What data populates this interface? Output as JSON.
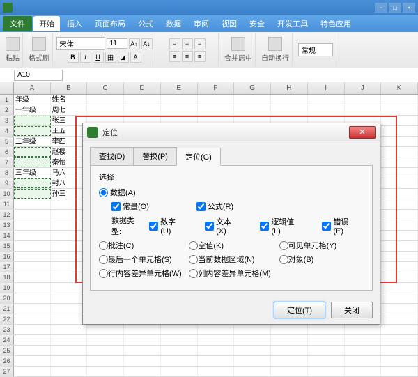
{
  "menu": {
    "file": "文件",
    "tabs": [
      "开始",
      "插入",
      "页面布局",
      "公式",
      "数据",
      "审阅",
      "视图",
      "安全",
      "开发工具",
      "特色应用"
    ],
    "active_tab": 0
  },
  "toolbar": {
    "paste": "粘贴",
    "format_painter": "格式刷",
    "font_name": "宋体",
    "font_size": "11",
    "merge": "合并居中",
    "wrap": "自动换行",
    "number_format": "常规"
  },
  "namebox": {
    "value": "A10"
  },
  "columns": [
    "A",
    "B",
    "C",
    "D",
    "E",
    "F",
    "G",
    "H",
    "I",
    "J",
    "K"
  ],
  "rows_data": [
    {
      "n": 1,
      "a": "年级",
      "b": "姓名",
      "sel": false
    },
    {
      "n": 2,
      "a": "一年级",
      "b": "周七",
      "sel": false
    },
    {
      "n": 3,
      "a": "",
      "b": "张三",
      "sel": true
    },
    {
      "n": 4,
      "a": "",
      "b": "王五",
      "sel": true
    },
    {
      "n": 5,
      "a": "二年级",
      "b": "李四",
      "sel": false
    },
    {
      "n": 6,
      "a": "",
      "b": "赵樱",
      "sel": true
    },
    {
      "n": 7,
      "a": "",
      "b": "秦怡",
      "sel": true
    },
    {
      "n": 8,
      "a": "三年级",
      "b": "马六",
      "sel": false
    },
    {
      "n": 9,
      "a": "",
      "b": "封八",
      "sel": true
    },
    {
      "n": 10,
      "a": "",
      "b": "孙三",
      "sel": true
    }
  ],
  "blank_rows": 17,
  "dialog": {
    "title": "定位",
    "tabs": {
      "find": "查找(D)",
      "replace": "替换(P)",
      "goto": "定位(G)"
    },
    "active_tab": "goto",
    "section": "选择",
    "opts": {
      "data": "数据(A)",
      "constant": "常量(O)",
      "formula": "公式(R)",
      "datatype": "数据类型:",
      "number": "数字(U)",
      "text": "文本(X)",
      "logic": "逻辑值(L)",
      "error": "错误(E)",
      "comment": "批注(C)",
      "blank": "空值(K)",
      "visible": "可见单元格(Y)",
      "last": "最后一个单元格(S)",
      "current_region": "当前数据区域(N)",
      "object": "对象(B)",
      "row_diff": "行内容差异单元格(W)",
      "col_diff": "列内容差异单元格(M)"
    },
    "buttons": {
      "ok": "定位(T)",
      "close": "关闭"
    }
  }
}
